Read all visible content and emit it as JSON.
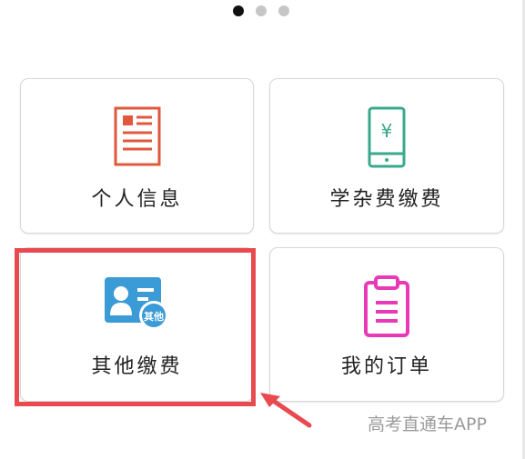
{
  "pager": {
    "total": 3,
    "active_index": 0
  },
  "cards": [
    {
      "label": "个人信息",
      "icon": "profile-document-icon",
      "color": "#e2583c"
    },
    {
      "label": "学杂费缴费",
      "icon": "phone-yuan-payment-icon",
      "color": "#3aa88c"
    },
    {
      "label": "其他缴费",
      "icon": "id-card-other-icon",
      "color": "#3a9bd6",
      "icon_badge": "其他"
    },
    {
      "label": "我的订单",
      "icon": "clipboard-order-icon",
      "color": "#e83ab7"
    }
  ],
  "annotation": {
    "highlight_color": "#e84a4f",
    "arrow_color": "#e84a4f"
  },
  "watermark": "高考直通车APP"
}
